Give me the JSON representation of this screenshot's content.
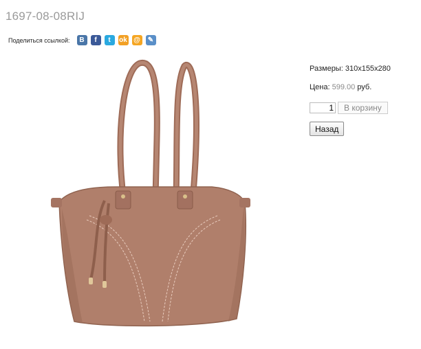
{
  "product": {
    "title": "1697-08-08RIJ"
  },
  "share": {
    "label": "Поделиться ссылкой:",
    "icons": [
      {
        "name": "vkontakte-icon",
        "glyph": "B",
        "color": "#4a76a8"
      },
      {
        "name": "facebook-icon",
        "glyph": "f",
        "color": "#3b5998"
      },
      {
        "name": "twitter-icon",
        "glyph": "t",
        "color": "#2aa9e0"
      },
      {
        "name": "odnoklassniki-icon",
        "glyph": "ok",
        "color": "#f2a024"
      },
      {
        "name": "mailru-icon",
        "glyph": "@",
        "color": "#f5a623"
      },
      {
        "name": "livejournal-icon",
        "glyph": "✎",
        "color": "#5a8fc8"
      }
    ]
  },
  "photo": {
    "icon": "handbag-photo",
    "bag_color": "#b07f6b"
  },
  "info": {
    "size_label": "Размеры:",
    "size_value": "310x155x280",
    "price_label": "Цена:",
    "price_value": "599.00",
    "currency": "руб.",
    "quantity": "1",
    "add_to_cart": "В корзину",
    "back": "Назад"
  }
}
